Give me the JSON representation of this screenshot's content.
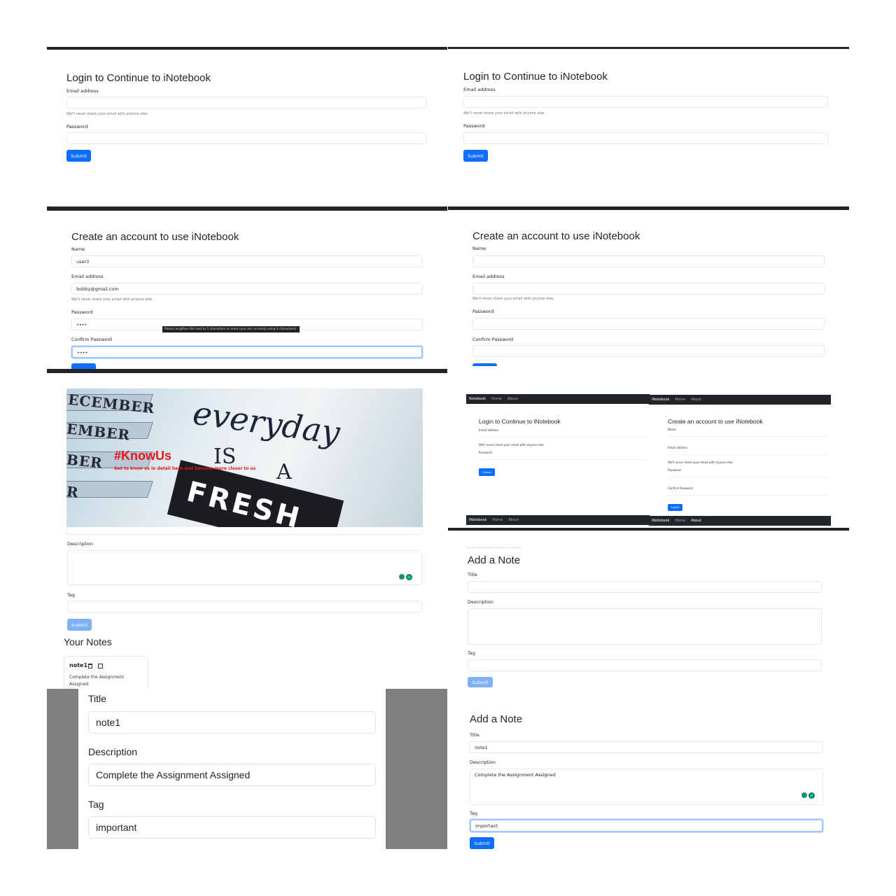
{
  "login": {
    "title": "Login to Continue to iNotebook",
    "email_label": "Email address",
    "email_help": "We'll never share your email with anyone else.",
    "password_label": "Password",
    "submit_label": "Submit"
  },
  "signup_filled": {
    "title": "Create an account to use iNotebook",
    "name_label": "Name",
    "name_value": "user3",
    "email_label": "Email address",
    "email_value": "bobby@gmail.com",
    "email_help": "We'll never share your email with anyone else.",
    "password_label": "Password",
    "password_value": "••••",
    "validation_tooltip": "Please lengthen this text to 5 characters or more (you are currently using 4 characters).",
    "confirm_label": "Confirm Password",
    "confirm_value": "••••"
  },
  "signup_empty": {
    "title": "Create an account to use iNotebook",
    "name_label": "Name",
    "email_label": "Email address",
    "email_help": "We'll never share your email with anyone else.",
    "password_label": "Password",
    "confirm_label": "Confirm Password"
  },
  "about": {
    "hero_heading": "#KnowUs",
    "hero_tagline": "Get to know us in detail here and become more closer to us",
    "hero_words": [
      "ECEMBER",
      "EMBER",
      "BER",
      "R"
    ],
    "hero_script_1": "everyday",
    "hero_script_2": "IS",
    "hero_script_3": "A",
    "hero_banner": "FRESH",
    "description_label": "Description",
    "tag_label": "Tag",
    "submit_label": "Submit",
    "your_notes": "Your Notes",
    "note_title": "note1",
    "note_description": "Complete the Assignment Assigned"
  },
  "navbar": {
    "brand": "iNotebook",
    "brand_cut": "Notebook",
    "home": "Home",
    "about": "About"
  },
  "edit_modal": {
    "title_label": "Title",
    "title_value": "note1",
    "description_label": "Description",
    "description_value": "Complete the Assignment Assigned",
    "tag_label": "Tag",
    "tag_value": "important"
  },
  "add_note_empty": {
    "heading": "Add a Note",
    "title_label": "Title",
    "description_label": "Description",
    "tag_label": "Tag",
    "submit_label": "Submit"
  },
  "add_note_filled": {
    "heading": "Add a Note",
    "title_label": "Title",
    "title_value": "note1",
    "description_label": "Description",
    "description_value": "Complete the Assignment Assigned",
    "tag_label": "Tag",
    "tag_value": "important",
    "submit_label": "Submit"
  },
  "colors": {
    "primary": "#0d6efd",
    "navbar": "#212529",
    "knowus_red": "#e8161b",
    "modal_backdrop": "#7f7f7f"
  }
}
